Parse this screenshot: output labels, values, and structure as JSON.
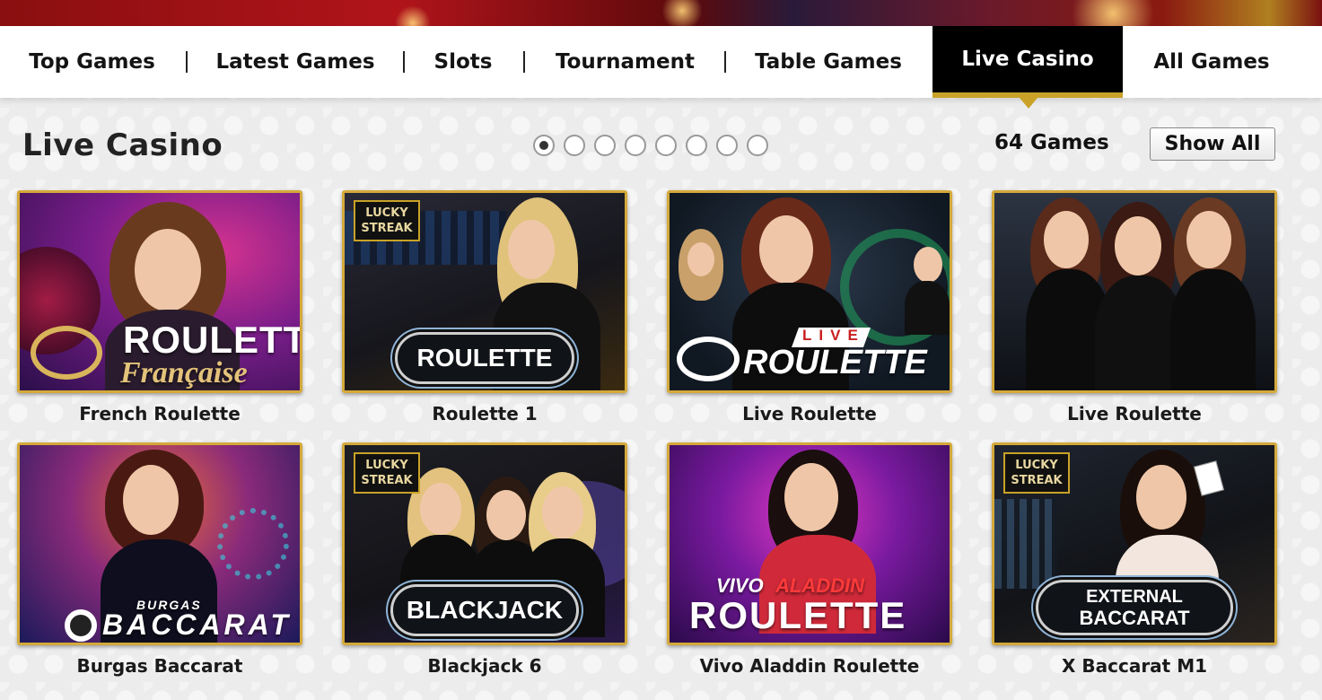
{
  "nav": {
    "items": [
      {
        "label": "Top Games"
      },
      {
        "label": "Latest Games"
      },
      {
        "label": "Slots"
      },
      {
        "label": "Tournament"
      },
      {
        "label": "Table Games"
      },
      {
        "label": "Live Casino"
      },
      {
        "label": "All Games"
      }
    ],
    "active": "Live Casino"
  },
  "section": {
    "title": "Live Casino",
    "count_label": "64 Games",
    "show_all_label": "Show All",
    "pagination": {
      "pages": 8,
      "current": 1
    }
  },
  "games": [
    {
      "name": "French Roulette",
      "art": {
        "line1": "ROULETTE",
        "line2": "Française"
      }
    },
    {
      "name": "Roulette 1",
      "art": {
        "badge": "LUCKY STREAK",
        "label": "ROULETTE"
      }
    },
    {
      "name": "Live Roulette",
      "art": {
        "tag": "LIVE",
        "label": "ROULETTE"
      }
    },
    {
      "name": "Live Roulette",
      "art": {}
    },
    {
      "name": "Burgas Baccarat",
      "art": {
        "line1": "BURGAS",
        "line2": "BACCARAT"
      }
    },
    {
      "name": "Blackjack 6",
      "art": {
        "badge": "LUCKY STREAK",
        "label": "BLACKJACK"
      }
    },
    {
      "name": "Vivo Aladdin Roulette",
      "art": {
        "brand_a": "VIVO",
        "brand_b": "ALADDIN",
        "label": "ROULETTE"
      }
    },
    {
      "name": "X Baccarat M1",
      "art": {
        "badge": "LUCKY STREAK",
        "line1": "EXTERNAL",
        "line2": "BACCARAT"
      }
    }
  ],
  "colors": {
    "accent_gold": "#c9a227",
    "nav_active_bg": "#000000",
    "page_bg": "#ececec"
  }
}
